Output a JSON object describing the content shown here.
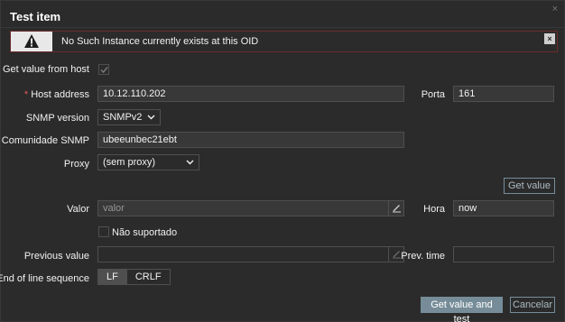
{
  "dialog": {
    "title": "Test item",
    "close_symbol": "×"
  },
  "message": {
    "text": "No Such Instance currently exists at this OID",
    "close_symbol": "×",
    "icon": "warning-icon"
  },
  "form": {
    "get_value_from_host_label": "Get value from host",
    "get_value_from_host_checked": true,
    "host_address_label": "Host address",
    "host_address_value": "10.12.110.202",
    "port_label": "Porta",
    "port_value": "161",
    "snmp_version_label": "SNMP version",
    "snmp_version_value": "SNMPv2",
    "community_label": "Comunidade SNMP",
    "community_value": "ubeeunbec21ebt",
    "proxy_label": "Proxy",
    "proxy_value": "(sem proxy)",
    "get_value_button": "Get value",
    "value_label": "Valor",
    "value_placeholder": "valor",
    "time_label": "Hora",
    "time_value": "now",
    "not_supported_label": "Não suportado",
    "previous_value_label": "Previous value",
    "prev_time_label": "Prev. time",
    "eol_label": "End of line sequence",
    "eol_options": [
      "LF",
      "CRLF"
    ],
    "eol_selected": "LF",
    "required_mark": "*"
  },
  "footer": {
    "primary_button": "Get value and test",
    "cancel_button": "Cancelar"
  },
  "colors": {
    "background": "#2b2b2b",
    "primary": "#768d99",
    "required": "#e45959",
    "error_border": "#6b2b2b"
  }
}
